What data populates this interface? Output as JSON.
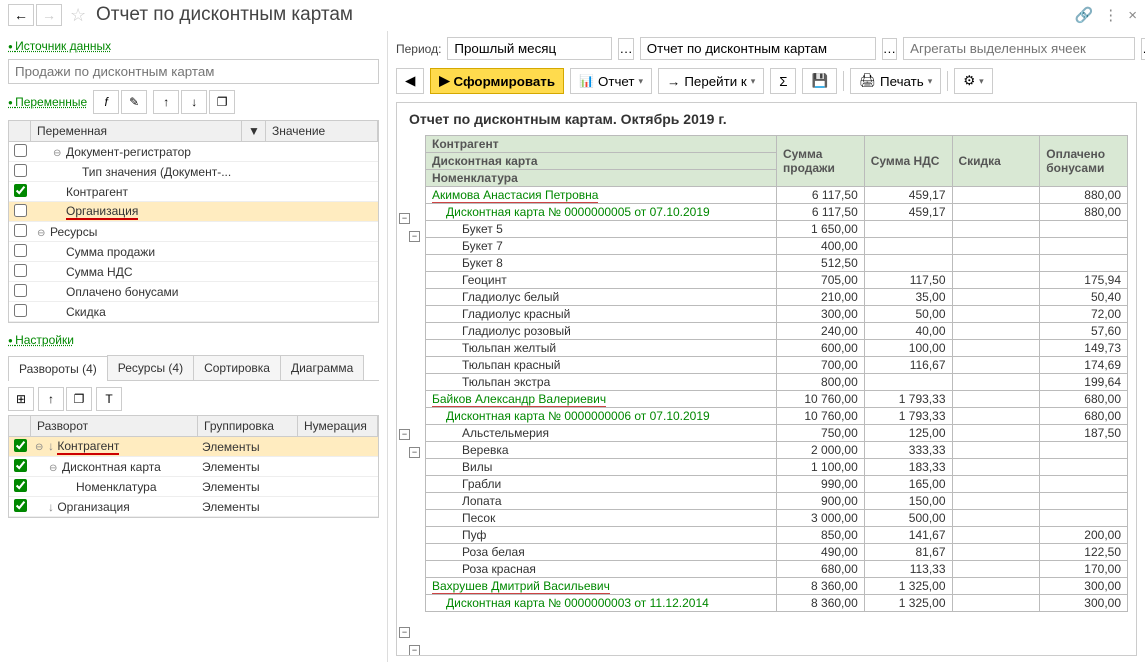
{
  "title": "Отчет по дисконтным картам",
  "left": {
    "source_link": "Источник данных",
    "search_placeholder": "Продажи по дисконтным картам",
    "vars_link": "Переменные",
    "var_header": {
      "name": "Переменная",
      "value": "Значение"
    },
    "vars": [
      {
        "checked": false,
        "indent": 1,
        "toggle": "⊖",
        "name": "Документ-регистратор"
      },
      {
        "checked": false,
        "indent": 2,
        "name": "Тип значения (Документ-..."
      },
      {
        "checked": true,
        "indent": 1,
        "name": "Контрагент"
      },
      {
        "checked": false,
        "indent": 1,
        "name": "Организация",
        "selected": true,
        "underline": true
      },
      {
        "checked": false,
        "indent": 0,
        "toggle": "⊖",
        "name": "Ресурсы"
      },
      {
        "checked": false,
        "indent": 1,
        "name": "Сумма продажи"
      },
      {
        "checked": false,
        "indent": 1,
        "name": "Сумма НДС"
      },
      {
        "checked": false,
        "indent": 1,
        "name": "Оплачено бонусами"
      },
      {
        "checked": false,
        "indent": 1,
        "name": "Скидка"
      }
    ],
    "settings_link": "Настройки",
    "tabs": [
      {
        "label": "Развороты (4)",
        "active": true
      },
      {
        "label": "Ресурсы (4)"
      },
      {
        "label": "Сортировка"
      },
      {
        "label": "Диаграмма"
      }
    ],
    "dev_header": {
      "name": "Разворот",
      "group": "Группировка",
      "num": "Нумерация"
    },
    "devs": [
      {
        "checked": true,
        "indent": 0,
        "toggle": "⊖",
        "arrow": "↓",
        "name": "Контрагент",
        "group": "Элементы",
        "selected": true,
        "underline": true
      },
      {
        "checked": true,
        "indent": 1,
        "toggle": "⊖",
        "name": "Дисконтная карта",
        "group": "Элементы"
      },
      {
        "checked": true,
        "indent": 2,
        "name": "Номенклатура",
        "group": "Элементы"
      },
      {
        "checked": true,
        "indent": 0,
        "arrow": "↓",
        "name": "Организация",
        "group": "Элементы"
      }
    ]
  },
  "right": {
    "period_label": "Период:",
    "period_val": "Прошлый месяц",
    "report_name": "Отчет по дисконтным картам",
    "aggregates_placeholder": "Агрегаты выделенных ячеек",
    "form_btn": "Сформировать",
    "otchet_btn": "Отчет",
    "goto_btn": "Перейти к",
    "print_btn": "Печать",
    "report_title": "Отчет по дисконтным картам. Октябрь 2019 г.",
    "columns": [
      "Контрагент",
      "Сумма продажи",
      "Сумма НДС",
      "Скидка",
      "Оплачено бонусами"
    ],
    "sub_headers": [
      "Дисконтная карта",
      "Номенклатура"
    ],
    "rows": [
      {
        "lvl": 0,
        "name": "Акимова Анастасия Петровна",
        "v": [
          "6 117,50",
          "459,17",
          "",
          "880,00"
        ],
        "ul": true
      },
      {
        "lvl": 1,
        "name": "Дисконтная карта № 0000000005 от 07.10.2019",
        "v": [
          "6 117,50",
          "459,17",
          "",
          "880,00"
        ]
      },
      {
        "lvl": 2,
        "name": "Букет 5",
        "v": [
          "1 650,00",
          "",
          "",
          ""
        ]
      },
      {
        "lvl": 2,
        "name": "Букет 7",
        "v": [
          "400,00",
          "",
          "",
          ""
        ]
      },
      {
        "lvl": 2,
        "name": "Букет 8",
        "v": [
          "512,50",
          "",
          "",
          ""
        ]
      },
      {
        "lvl": 2,
        "name": "Геоцинт",
        "v": [
          "705,00",
          "117,50",
          "",
          "175,94"
        ]
      },
      {
        "lvl": 2,
        "name": "Гладиолус белый",
        "v": [
          "210,00",
          "35,00",
          "",
          "50,40"
        ]
      },
      {
        "lvl": 2,
        "name": "Гладиолус красный",
        "v": [
          "300,00",
          "50,00",
          "",
          "72,00"
        ]
      },
      {
        "lvl": 2,
        "name": "Гладиолус розовый",
        "v": [
          "240,00",
          "40,00",
          "",
          "57,60"
        ]
      },
      {
        "lvl": 2,
        "name": "Тюльпан желтый",
        "v": [
          "600,00",
          "100,00",
          "",
          "149,73"
        ]
      },
      {
        "lvl": 2,
        "name": "Тюльпан красный",
        "v": [
          "700,00",
          "116,67",
          "",
          "174,69"
        ]
      },
      {
        "lvl": 2,
        "name": "Тюльпан экстра",
        "v": [
          "800,00",
          "",
          "",
          "199,64"
        ]
      },
      {
        "lvl": 0,
        "name": "Байков Александр Валериевич",
        "v": [
          "10 760,00",
          "1 793,33",
          "",
          "680,00"
        ],
        "ul": true
      },
      {
        "lvl": 1,
        "name": "Дисконтная карта № 0000000006 от 07.10.2019",
        "v": [
          "10 760,00",
          "1 793,33",
          "",
          "680,00"
        ]
      },
      {
        "lvl": 2,
        "name": "Альстельмерия",
        "v": [
          "750,00",
          "125,00",
          "",
          "187,50"
        ]
      },
      {
        "lvl": 2,
        "name": "Веревка",
        "v": [
          "2 000,00",
          "333,33",
          "",
          ""
        ]
      },
      {
        "lvl": 2,
        "name": "Вилы",
        "v": [
          "1 100,00",
          "183,33",
          "",
          ""
        ]
      },
      {
        "lvl": 2,
        "name": "Грабли",
        "v": [
          "990,00",
          "165,00",
          "",
          ""
        ]
      },
      {
        "lvl": 2,
        "name": "Лопата",
        "v": [
          "900,00",
          "150,00",
          "",
          ""
        ]
      },
      {
        "lvl": 2,
        "name": "Песок",
        "v": [
          "3 000,00",
          "500,00",
          "",
          ""
        ]
      },
      {
        "lvl": 2,
        "name": "Пуф",
        "v": [
          "850,00",
          "141,67",
          "",
          "200,00"
        ]
      },
      {
        "lvl": 2,
        "name": "Роза белая",
        "v": [
          "490,00",
          "81,67",
          "",
          "122,50"
        ]
      },
      {
        "lvl": 2,
        "name": "Роза красная",
        "v": [
          "680,00",
          "113,33",
          "",
          "170,00"
        ]
      },
      {
        "lvl": 0,
        "name": "Вахрушев Дмитрий Васильевич",
        "v": [
          "8 360,00",
          "1 325,00",
          "",
          "300,00"
        ],
        "ul": true
      },
      {
        "lvl": 1,
        "name": "Дисконтная карта № 0000000003 от 11.12.2014",
        "v": [
          "8 360,00",
          "1 325,00",
          "",
          "300,00"
        ]
      }
    ]
  }
}
